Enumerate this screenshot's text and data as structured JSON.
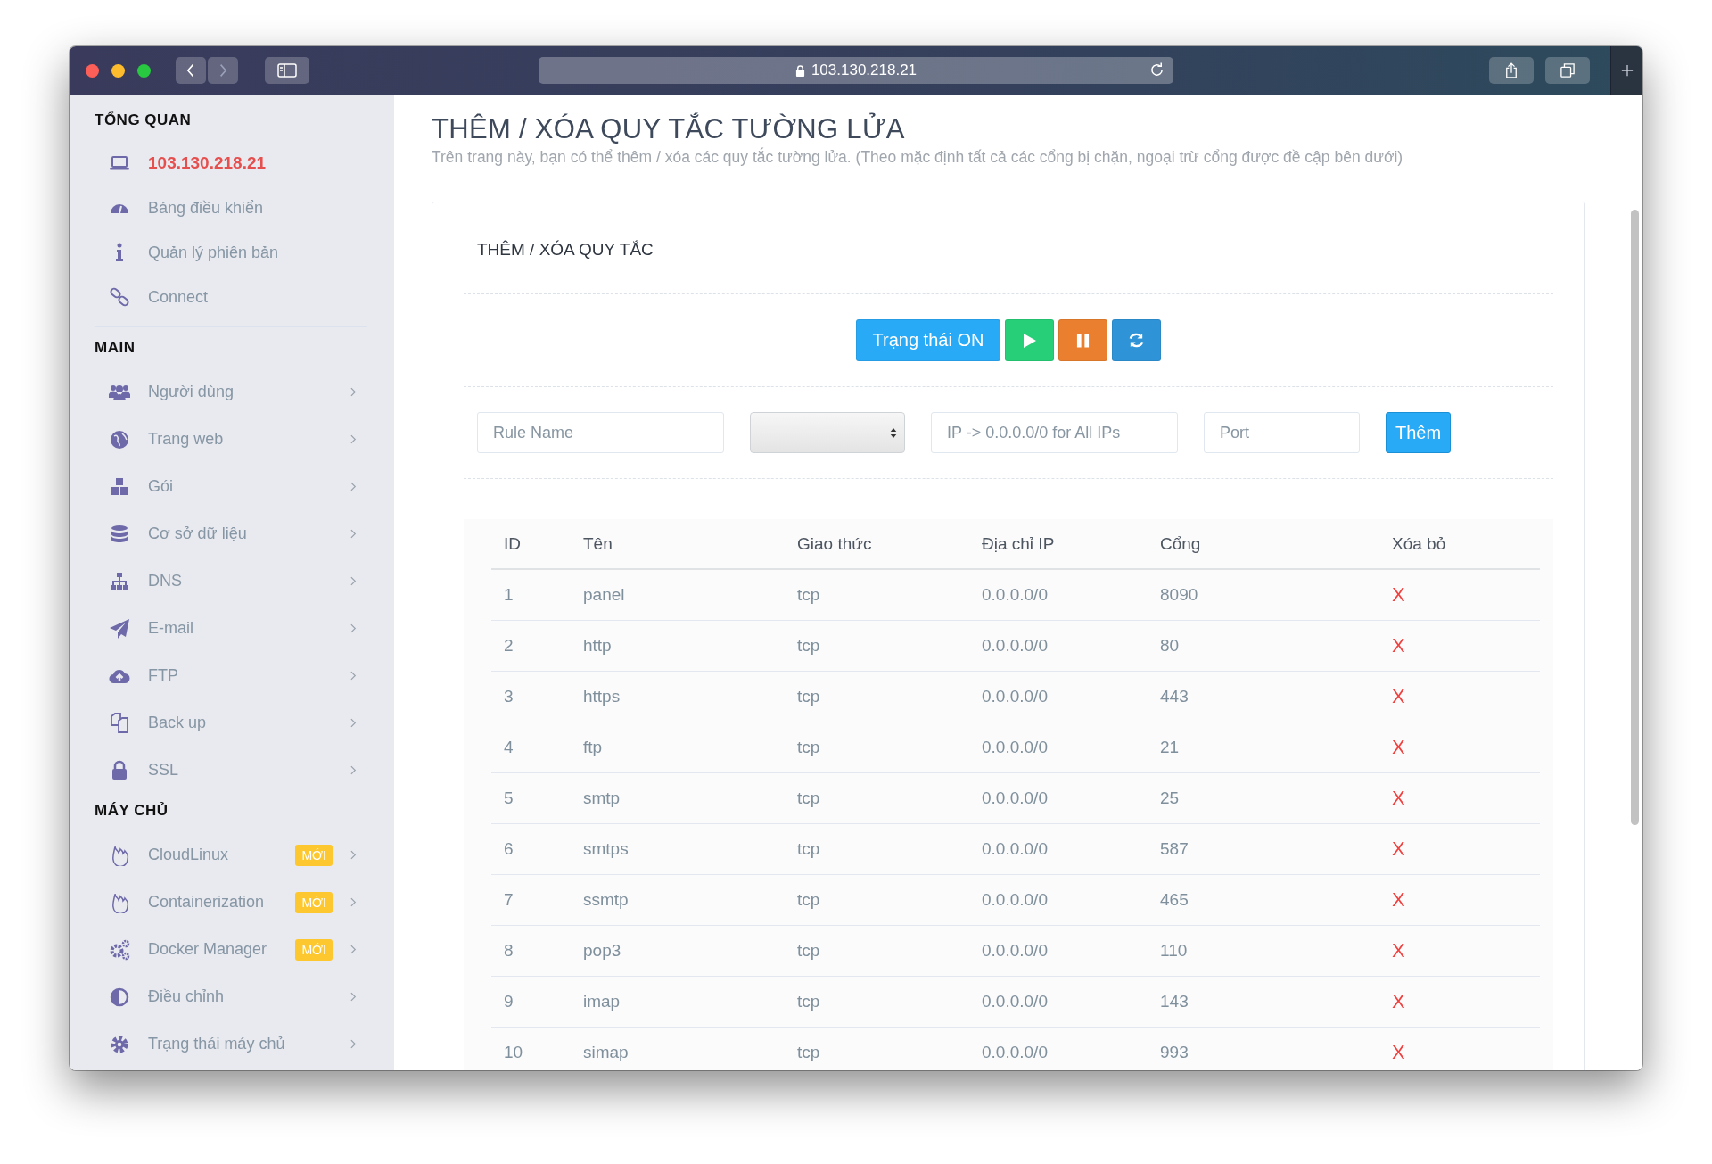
{
  "browser": {
    "address": "103.130.218.21"
  },
  "sidebar": {
    "sections": [
      {
        "heading": "TỔNG QUAN",
        "items": [
          {
            "label": "103.130.218.21",
            "selected": true,
            "submenu": false
          },
          {
            "label": "Bảng điều khiển",
            "selected": false,
            "submenu": false
          },
          {
            "label": "Quản lý phiên bản",
            "selected": false,
            "submenu": false
          },
          {
            "label": "Connect",
            "selected": false,
            "submenu": false
          }
        ]
      },
      {
        "heading": "MAIN",
        "items": [
          {
            "label": "Người dùng",
            "selected": false,
            "submenu": true
          },
          {
            "label": "Trang web",
            "selected": false,
            "submenu": true
          },
          {
            "label": "Gói",
            "selected": false,
            "submenu": true
          },
          {
            "label": "Cơ sở dữ liệu",
            "selected": false,
            "submenu": true
          },
          {
            "label": "DNS",
            "selected": false,
            "submenu": true
          },
          {
            "label": "E-mail",
            "selected": false,
            "submenu": true
          },
          {
            "label": "FTP",
            "selected": false,
            "submenu": true
          },
          {
            "label": "Back up",
            "selected": false,
            "submenu": true
          },
          {
            "label": "SSL",
            "selected": false,
            "submenu": true
          }
        ]
      },
      {
        "heading": "MÁY CHỦ",
        "items": [
          {
            "label": "CloudLinux",
            "badge": "MỚI",
            "selected": false,
            "submenu": true
          },
          {
            "label": "Containerization",
            "badge": "MỚI",
            "selected": false,
            "submenu": true
          },
          {
            "label": "Docker Manager",
            "badge": "MỚI",
            "selected": false,
            "submenu": true
          },
          {
            "label": "Điều chỉnh",
            "selected": false,
            "submenu": true
          },
          {
            "label": "Trạng thái máy chủ",
            "selected": false,
            "submenu": true
          }
        ]
      }
    ]
  },
  "page": {
    "title": "THÊM / XÓA QUY TẮC TƯỜNG LỬA",
    "subtitle": "Trên trang này, bạn có thể thêm / xóa các quy tắc tường lửa. (Theo mặc định tất cả các cổng bị chặn, ngoại trừ cổng được đề cập bên dưới)"
  },
  "card": {
    "title": "THÊM / XÓA QUY TẮC",
    "status_button": "Trạng thái ON",
    "form": {
      "rule_name": {
        "placeholder": "Rule Name"
      },
      "ip": {
        "placeholder": "IP -> 0.0.0.0/0 for All IPs"
      },
      "port": {
        "placeholder": "Port"
      },
      "add_button": "Thêm"
    },
    "table": {
      "columns": [
        "ID",
        "Tên",
        "Giao thức",
        "Địa chỉ IP",
        "Cổng",
        "Xóa bỏ"
      ],
      "rows": [
        {
          "id": "1",
          "name": "panel",
          "protocol": "tcp",
          "ip": "0.0.0.0/0",
          "port": "8090",
          "delete": "X"
        },
        {
          "id": "2",
          "name": "http",
          "protocol": "tcp",
          "ip": "0.0.0.0/0",
          "port": "80",
          "delete": "X"
        },
        {
          "id": "3",
          "name": "https",
          "protocol": "tcp",
          "ip": "0.0.0.0/0",
          "port": "443",
          "delete": "X"
        },
        {
          "id": "4",
          "name": "ftp",
          "protocol": "tcp",
          "ip": "0.0.0.0/0",
          "port": "21",
          "delete": "X"
        },
        {
          "id": "5",
          "name": "smtp",
          "protocol": "tcp",
          "ip": "0.0.0.0/0",
          "port": "25",
          "delete": "X"
        },
        {
          "id": "6",
          "name": "smtps",
          "protocol": "tcp",
          "ip": "0.0.0.0/0",
          "port": "587",
          "delete": "X"
        },
        {
          "id": "7",
          "name": "ssmtp",
          "protocol": "tcp",
          "ip": "0.0.0.0/0",
          "port": "465",
          "delete": "X"
        },
        {
          "id": "8",
          "name": "pop3",
          "protocol": "tcp",
          "ip": "0.0.0.0/0",
          "port": "110",
          "delete": "X"
        },
        {
          "id": "9",
          "name": "imap",
          "protocol": "tcp",
          "ip": "0.0.0.0/0",
          "port": "143",
          "delete": "X"
        },
        {
          "id": "10",
          "name": "simap",
          "protocol": "tcp",
          "ip": "0.0.0.0/0",
          "port": "993",
          "delete": "X"
        }
      ]
    }
  }
}
